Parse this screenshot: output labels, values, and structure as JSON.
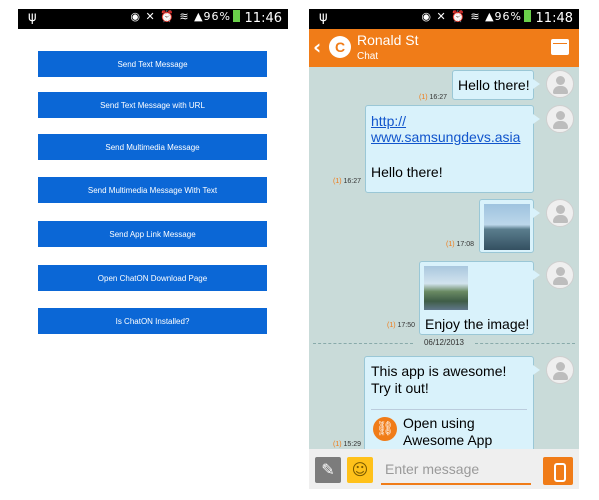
{
  "left_screen": {
    "status": {
      "battery": "96%",
      "time": "11:46"
    },
    "buttons": [
      "Send Text Message",
      "Send Text Message with URL",
      "Send Multimedia Message",
      "Send Multimedia Message With Text",
      "Send App Link Message",
      "Open ChatON Download Page",
      "Is ChatON Installed?"
    ]
  },
  "right_screen": {
    "status": {
      "battery": "96%",
      "time": "11:48"
    },
    "header": {
      "logo": "C",
      "name": "Ronald St",
      "subtitle": "Chat"
    },
    "messages": [
      {
        "count": "(1)",
        "time": "16:27",
        "text": "Hello there!"
      },
      {
        "count": "(1)",
        "time": "16:27",
        "link": "http://\nwww.samsungdevs.asia",
        "text": "Hello there!"
      },
      {
        "count": "(1)",
        "time": "17:08"
      },
      {
        "count": "(1)",
        "time": "17:50",
        "text": "Enjoy the image!"
      },
      {
        "count": "(1)",
        "time": "15:29",
        "text": "This app is awesome!\nTry it out!",
        "app_link": "Open using\nAwesome App"
      }
    ],
    "date_separator": "06/12/2013",
    "input": {
      "placeholder": "Enter message"
    }
  }
}
